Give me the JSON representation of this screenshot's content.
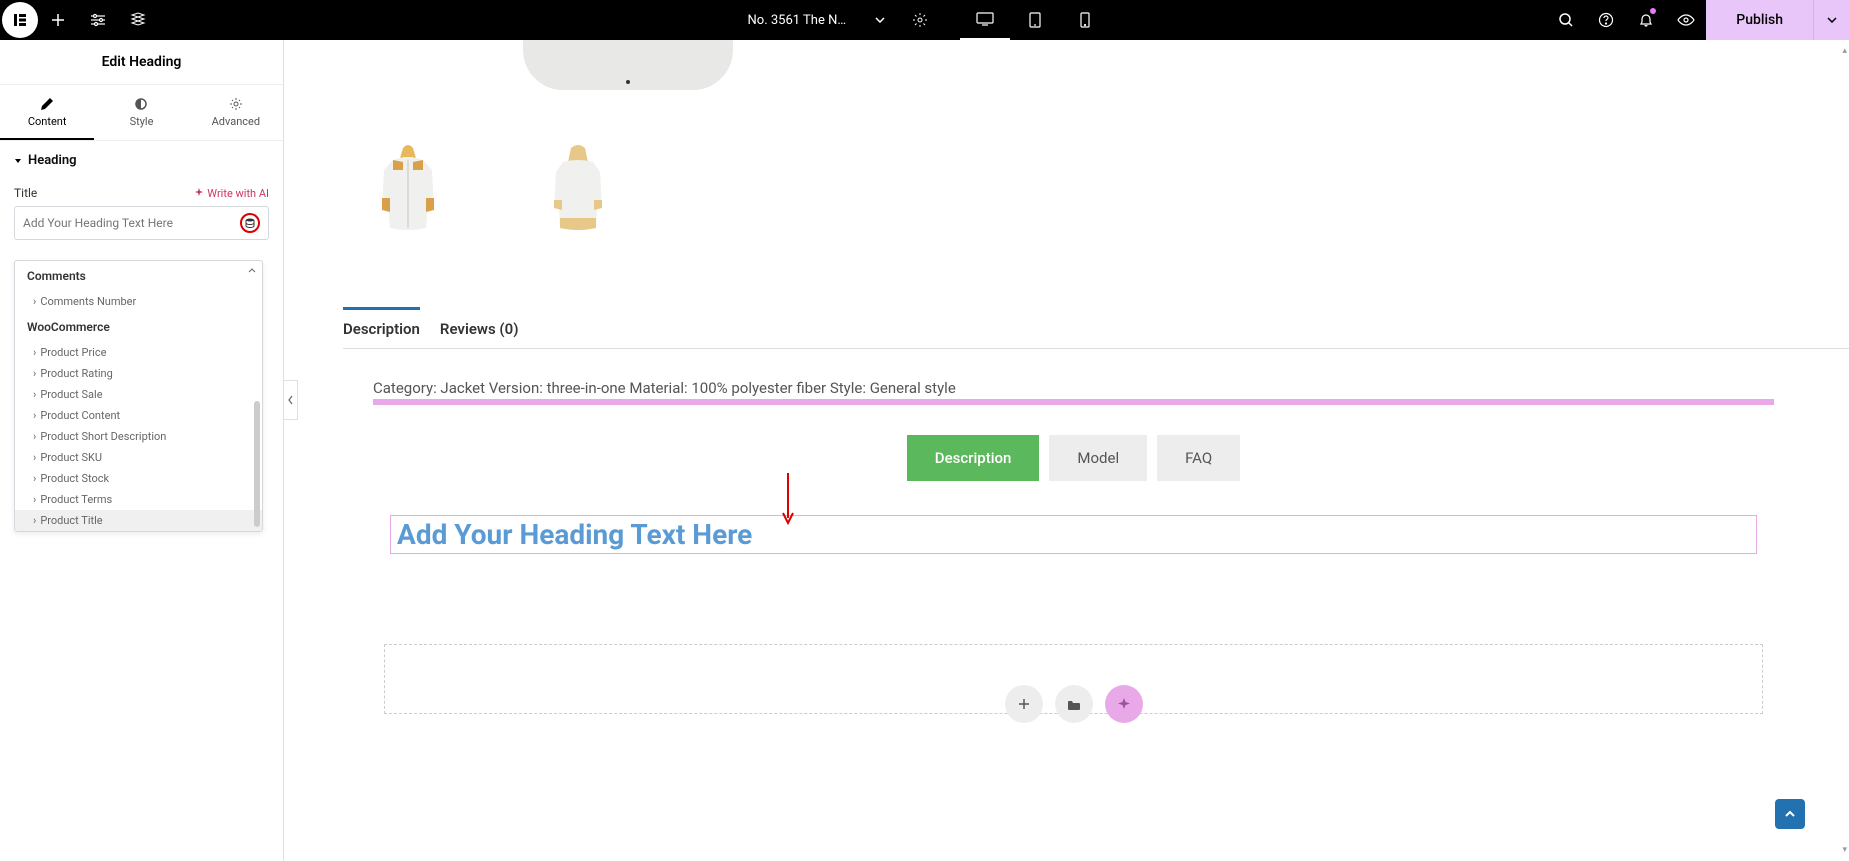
{
  "topbar": {
    "doc_title": "No. 3561 The No…",
    "publish": "Publish"
  },
  "sidebar": {
    "panel_title": "Edit Heading",
    "tabs": {
      "content": "Content",
      "style": "Style",
      "advanced": "Advanced"
    },
    "section": "Heading",
    "field": {
      "label": "Title",
      "write_ai": "Write with AI",
      "placeholder": "Add Your Heading Text Here"
    },
    "dropdown": {
      "group_comments": "Comments",
      "comments_number": "Comments Number",
      "group_woo": "WooCommerce",
      "items": [
        "Product Price",
        "Product Rating",
        "Product Sale",
        "Product Content",
        "Product Short Description",
        "Product SKU",
        "Product Stock",
        "Product Terms",
        "Product Title"
      ]
    }
  },
  "canvas": {
    "tabs": {
      "description": "Description",
      "reviews": "Reviews (0)"
    },
    "desc_text": "Category: Jacket Version: three-in-one Material: 100% polyester fiber Style: General style",
    "inner_tabs": {
      "description": "Description",
      "model": "Model",
      "faq": "FAQ"
    },
    "heading_text": "Add Your Heading Text Here"
  }
}
